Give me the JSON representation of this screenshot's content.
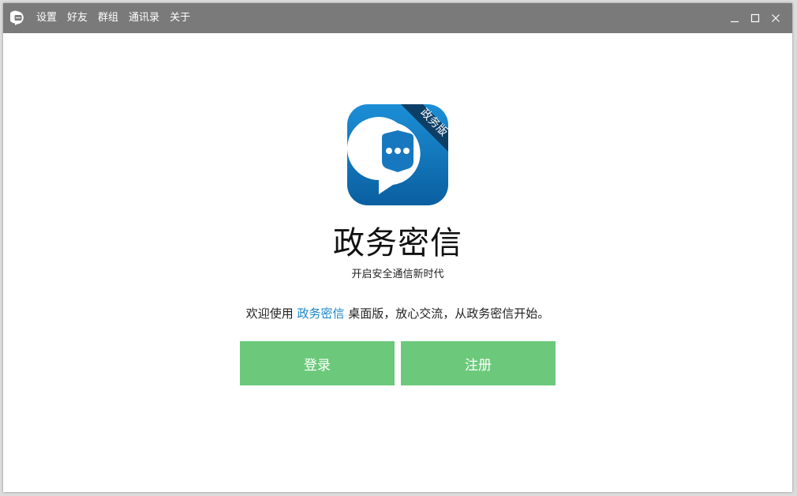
{
  "titlebar": {
    "logo_icon": "chat-bubble-icon",
    "menu": [
      "设置",
      "好友",
      "群组",
      "通讯录",
      "关于"
    ],
    "controls": [
      "minimize-icon",
      "maximize-icon",
      "close-icon"
    ]
  },
  "branding": {
    "logo_icon": "chat-bubble-dots-icon",
    "ribbon_text": "政务版",
    "app_name": "政务密信",
    "slogan": "开启安全通信新时代"
  },
  "welcome": {
    "prefix": "欢迎使用 ",
    "highlight": "政务密信",
    "suffix": " 桌面版，放心交流，从政务密信开始。"
  },
  "buttons": {
    "login": "登录",
    "register": "注册"
  },
  "colors": {
    "titlebar": "#7a7a7a",
    "button": "#6cc97b",
    "highlight": "#1a86c7",
    "logo_top": "#1c8fd6",
    "logo_bottom": "#0a5fa0",
    "ribbon": "#0d3f66"
  }
}
